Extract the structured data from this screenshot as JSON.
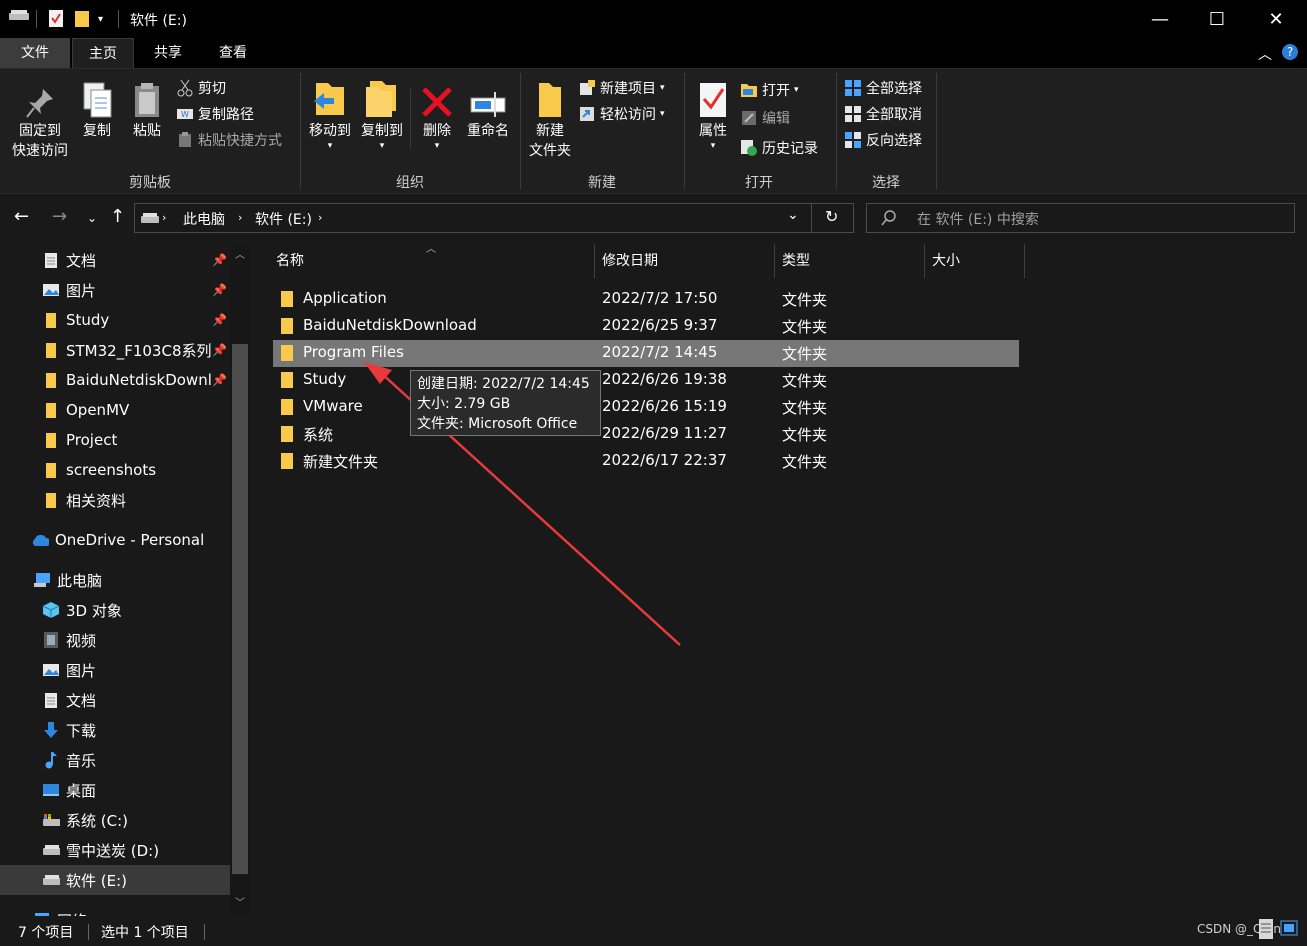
{
  "window": {
    "title": "软件 (E:)",
    "minimize": "—",
    "maximize": "☐",
    "close": "✕"
  },
  "ribbon_tabs": [
    "文件",
    "主页",
    "共享",
    "查看"
  ],
  "ribbon": {
    "clipboard": {
      "pin_label_1": "固定到",
      "pin_label_2": "快速访问",
      "copy": "复制",
      "paste": "粘贴",
      "cut": "剪切",
      "copy_path": "复制路径",
      "paste_shortcut": "粘贴快捷方式",
      "group": "剪贴板"
    },
    "organize": {
      "move_to": "移动到",
      "copy_to": "复制到",
      "delete": "删除",
      "rename": "重命名",
      "group": "组织"
    },
    "new": {
      "new_folder_1": "新建",
      "new_folder_2": "文件夹",
      "new_item": "新建项目",
      "easy_access": "轻松访问",
      "group": "新建"
    },
    "open": {
      "properties": "属性",
      "open": "打开",
      "edit": "编辑",
      "history": "历史记录",
      "group": "打开"
    },
    "select": {
      "select_all": "全部选择",
      "select_none": "全部取消",
      "invert": "反向选择",
      "group": "选择"
    }
  },
  "address": {
    "crumbs": [
      "此电脑",
      "软件 (E:)"
    ],
    "search_placeholder": "在 软件 (E:) 中搜索"
  },
  "sidebar": {
    "quick_access": [
      {
        "label": "文档",
        "pinned": true
      },
      {
        "label": "图片",
        "pinned": true
      },
      {
        "label": "Study",
        "pinned": true
      },
      {
        "label": "STM32_F103C8系列",
        "pinned": true
      },
      {
        "label": "BaiduNetdiskDownl",
        "pinned": true
      },
      {
        "label": "OpenMV"
      },
      {
        "label": "Project"
      },
      {
        "label": "screenshots"
      },
      {
        "label": "相关资料"
      }
    ],
    "onedrive": "OneDrive - Personal",
    "this_pc": "此电脑",
    "pc_items": [
      "3D 对象",
      "视频",
      "图片",
      "文档",
      "下载",
      "音乐",
      "桌面",
      "系统 (C:)",
      "雪中送炭 (D:)",
      "软件 (E:)"
    ],
    "network": "网络"
  },
  "columns": [
    "名称",
    "修改日期",
    "类型",
    "大小"
  ],
  "files": [
    {
      "name": "Application",
      "date": "2022/7/2 17:50",
      "type": "文件夹"
    },
    {
      "name": "BaiduNetdiskDownload",
      "date": "2022/6/25 9:37",
      "type": "文件夹"
    },
    {
      "name": "Program Files",
      "date": "2022/7/2 14:45",
      "type": "文件夹"
    },
    {
      "name": "Study",
      "date": "2022/6/26 19:38",
      "type": "文件夹"
    },
    {
      "name": "VMware",
      "date": "2022/6/26 15:19",
      "type": "文件夹"
    },
    {
      "name": "系统",
      "date": "2022/6/29 11:27",
      "type": "文件夹"
    },
    {
      "name": "新建文件夹",
      "date": "2022/6/17 22:37",
      "type": "文件夹"
    }
  ],
  "tooltip": {
    "created": "创建日期: 2022/7/2 14:45",
    "size": "大小: 2.79 GB",
    "folders": "文件夹: Microsoft Office"
  },
  "status": {
    "count": "7 个项目",
    "selected": "选中 1 个项目",
    "watermark": "CSDN @_Quin"
  },
  "colors": {
    "folder": "#f8c94a",
    "accent": "#4aa3ff",
    "delete": "#e81123",
    "arrow": "#e83a3a"
  }
}
